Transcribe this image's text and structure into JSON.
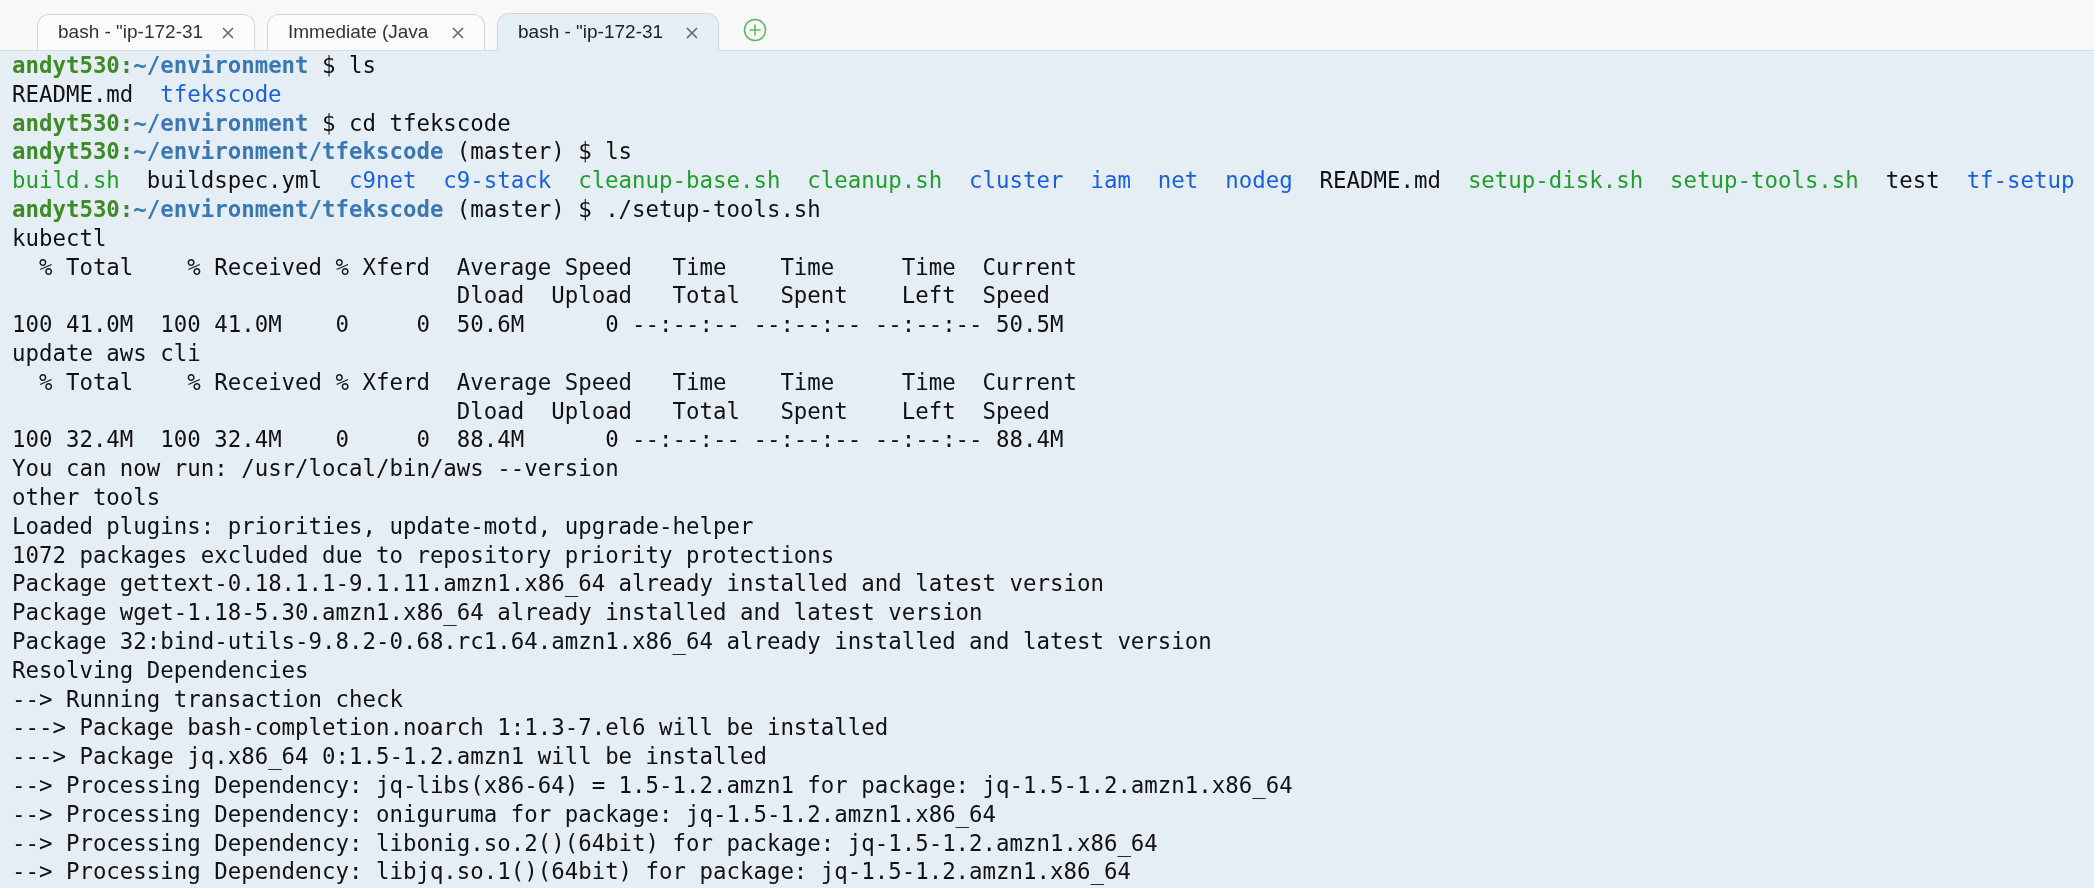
{
  "tabs": [
    {
      "label": "bash - \"ip-172-31",
      "selected": false
    },
    {
      "label": "Immediate (Java",
      "selected": false
    },
    {
      "label": "bash - \"ip-172-31",
      "selected": true
    }
  ],
  "terminal": {
    "lines": [
      {
        "kind": "prompt",
        "user": "andyt530:",
        "path": "~/environment",
        "command": "$ ls"
      },
      {
        "kind": "listing",
        "entries": [
          {
            "name": "README.md",
            "kind": "file"
          },
          {
            "name": "tfekscode",
            "kind": "dir"
          }
        ]
      },
      {
        "kind": "prompt",
        "user": "andyt530:",
        "path": "~/environment",
        "command": "$ cd tfekscode"
      },
      {
        "kind": "prompt",
        "user": "andyt530:",
        "path": "~/environment/tfekscode",
        "command": "(master) $ ls"
      },
      {
        "kind": "listing",
        "entries": [
          {
            "name": "build.sh",
            "kind": "exec"
          },
          {
            "name": "buildspec.yml",
            "kind": "file"
          },
          {
            "name": "c9net",
            "kind": "dir"
          },
          {
            "name": "c9-stack",
            "kind": "dir"
          },
          {
            "name": "cleanup-base.sh",
            "kind": "exec"
          },
          {
            "name": "cleanup.sh",
            "kind": "exec"
          },
          {
            "name": "cluster",
            "kind": "dir"
          },
          {
            "name": "iam",
            "kind": "dir"
          },
          {
            "name": "net",
            "kind": "dir"
          },
          {
            "name": "nodeg",
            "kind": "dir"
          },
          {
            "name": "README.md",
            "kind": "file"
          },
          {
            "name": "setup-disk.sh",
            "kind": "exec"
          },
          {
            "name": "setup-tools.sh",
            "kind": "exec"
          },
          {
            "name": "test",
            "kind": "file"
          },
          {
            "name": "tf-setup",
            "kind": "dir"
          }
        ]
      },
      {
        "kind": "prompt",
        "user": "andyt530:",
        "path": "~/environment/tfekscode",
        "command": "(master) $ ./setup-tools.sh"
      },
      {
        "kind": "output",
        "text": "kubectl"
      },
      {
        "kind": "output",
        "text": "  % Total    % Received % Xferd  Average Speed   Time    Time     Time  Current"
      },
      {
        "kind": "output",
        "text": "                                 Dload  Upload   Total   Spent    Left  Speed"
      },
      {
        "kind": "output",
        "text": "100 41.0M  100 41.0M    0     0  50.6M      0 --:--:-- --:--:-- --:--:-- 50.5M"
      },
      {
        "kind": "output",
        "text": "update aws cli"
      },
      {
        "kind": "output",
        "text": "  % Total    % Received % Xferd  Average Speed   Time    Time     Time  Current"
      },
      {
        "kind": "output",
        "text": "                                 Dload  Upload   Total   Spent    Left  Speed"
      },
      {
        "kind": "output",
        "text": "100 32.4M  100 32.4M    0     0  88.4M      0 --:--:-- --:--:-- --:--:-- 88.4M"
      },
      {
        "kind": "output",
        "text": "You can now run: /usr/local/bin/aws --version"
      },
      {
        "kind": "output",
        "text": "other tools"
      },
      {
        "kind": "output",
        "text": "Loaded plugins: priorities, update-motd, upgrade-helper"
      },
      {
        "kind": "output",
        "text": "1072 packages excluded due to repository priority protections"
      },
      {
        "kind": "output",
        "text": "Package gettext-0.18.1.1-9.1.11.amzn1.x86_64 already installed and latest version"
      },
      {
        "kind": "output",
        "text": "Package wget-1.18-5.30.amzn1.x86_64 already installed and latest version"
      },
      {
        "kind": "output",
        "text": "Package 32:bind-utils-9.8.2-0.68.rc1.64.amzn1.x86_64 already installed and latest version"
      },
      {
        "kind": "output",
        "text": "Resolving Dependencies"
      },
      {
        "kind": "output",
        "text": "--> Running transaction check"
      },
      {
        "kind": "output",
        "text": "---> Package bash-completion.noarch 1:1.3-7.el6 will be installed"
      },
      {
        "kind": "output",
        "text": "---> Package jq.x86_64 0:1.5-1.2.amzn1 will be installed"
      },
      {
        "kind": "output",
        "text": "--> Processing Dependency: jq-libs(x86-64) = 1.5-1.2.amzn1 for package: jq-1.5-1.2.amzn1.x86_64"
      },
      {
        "kind": "output",
        "text": "--> Processing Dependency: oniguruma for package: jq-1.5-1.2.amzn1.x86_64"
      },
      {
        "kind": "output",
        "text": "--> Processing Dependency: libonig.so.2()(64bit) for package: jq-1.5-1.2.amzn1.x86_64"
      },
      {
        "kind": "output",
        "text": "--> Processing Dependency: libjq.so.1()(64bit) for package: jq-1.5-1.2.amzn1.x86_64"
      }
    ]
  }
}
